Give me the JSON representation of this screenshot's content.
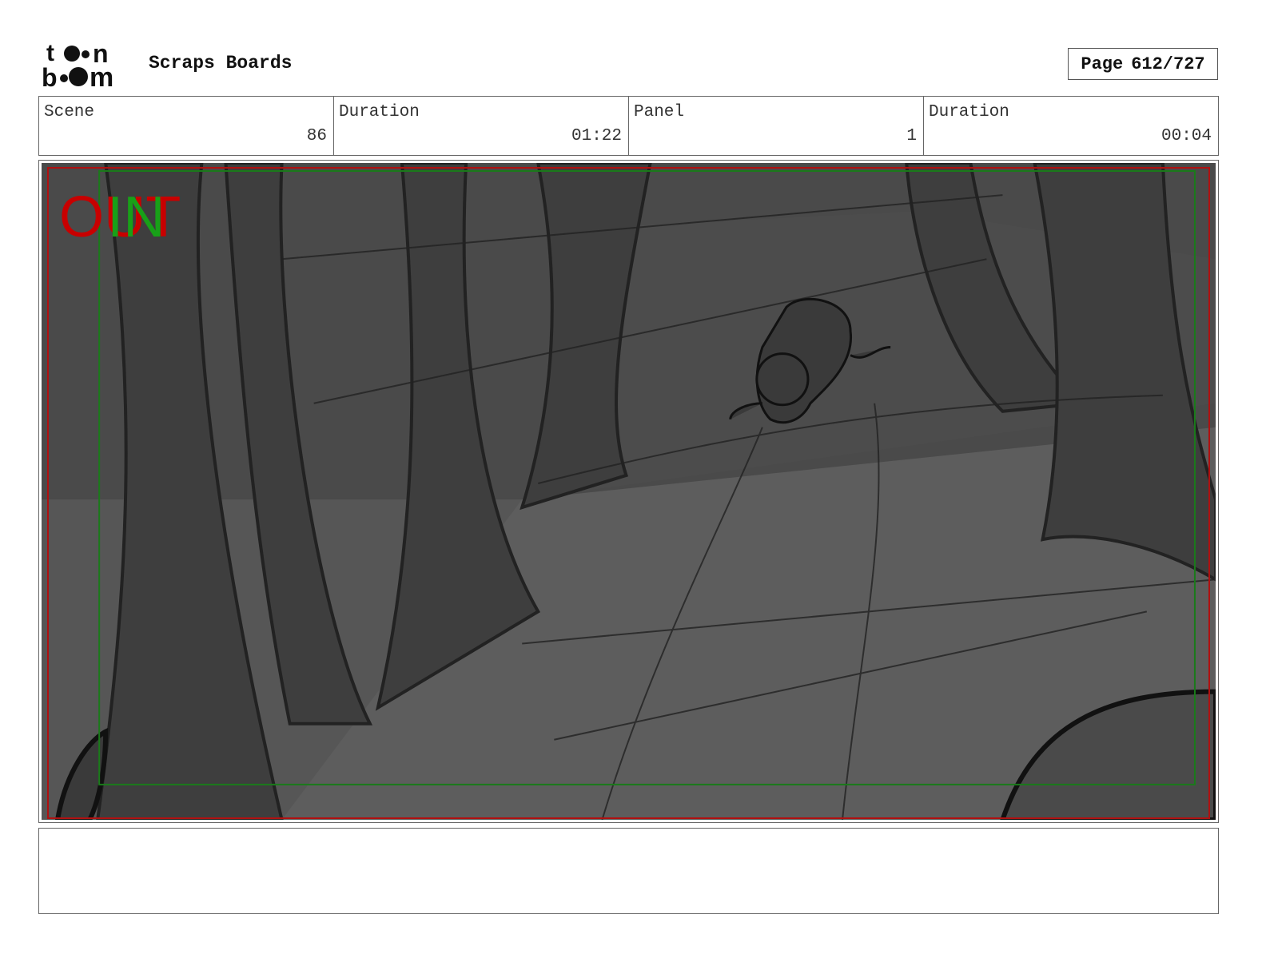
{
  "header": {
    "logo_text": "toon boom",
    "project_title": "Scraps Boards",
    "page_label": "Page",
    "page_value": "612/727"
  },
  "info": [
    {
      "label": "Scene",
      "value": "86"
    },
    {
      "label": "Duration",
      "value": "01:22"
    },
    {
      "label": "Panel",
      "value": "1"
    },
    {
      "label": "Duration",
      "value": "00:04"
    }
  ],
  "panel": {
    "overlay_out": "OUT",
    "overlay_in": "IN",
    "colors": {
      "out": "#c80000",
      "in": "#18a018",
      "safe_red": "#b01010",
      "safe_green": "#1a7a1a"
    }
  },
  "notes": {
    "text": ""
  }
}
